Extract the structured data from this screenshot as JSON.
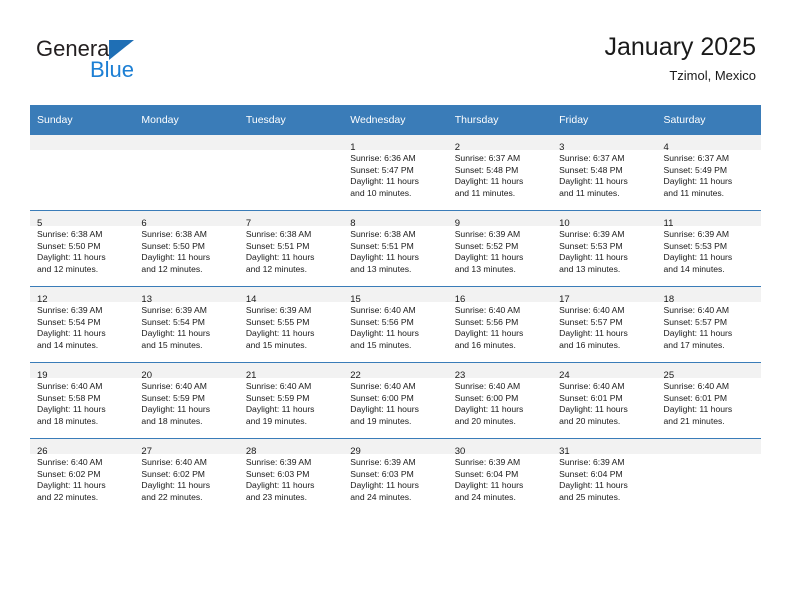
{
  "brand": {
    "name_top": "General",
    "name_bottom": "Blue",
    "triangle_color": "#1f6fb5",
    "blue_color": "#1c7fd4"
  },
  "header": {
    "title": "January 2025",
    "subtitle": "Tzimol, Mexico"
  },
  "theme": {
    "header_bg": "#3a7cb8",
    "daynum_bg": "#f2f2f2",
    "text": "#1a1a1a"
  },
  "calendar": {
    "weekday_headers": [
      "Sunday",
      "Monday",
      "Tuesday",
      "Wednesday",
      "Thursday",
      "Friday",
      "Saturday"
    ],
    "weeks": [
      [
        {
          "day": "",
          "lines": []
        },
        {
          "day": "",
          "lines": []
        },
        {
          "day": "",
          "lines": []
        },
        {
          "day": "1",
          "lines": [
            "Sunrise: 6:36 AM",
            "Sunset: 5:47 PM",
            "Daylight: 11 hours",
            "and 10 minutes."
          ]
        },
        {
          "day": "2",
          "lines": [
            "Sunrise: 6:37 AM",
            "Sunset: 5:48 PM",
            "Daylight: 11 hours",
            "and 11 minutes."
          ]
        },
        {
          "day": "3",
          "lines": [
            "Sunrise: 6:37 AM",
            "Sunset: 5:48 PM",
            "Daylight: 11 hours",
            "and 11 minutes."
          ]
        },
        {
          "day": "4",
          "lines": [
            "Sunrise: 6:37 AM",
            "Sunset: 5:49 PM",
            "Daylight: 11 hours",
            "and 11 minutes."
          ]
        }
      ],
      [
        {
          "day": "5",
          "lines": [
            "Sunrise: 6:38 AM",
            "Sunset: 5:50 PM",
            "Daylight: 11 hours",
            "and 12 minutes."
          ]
        },
        {
          "day": "6",
          "lines": [
            "Sunrise: 6:38 AM",
            "Sunset: 5:50 PM",
            "Daylight: 11 hours",
            "and 12 minutes."
          ]
        },
        {
          "day": "7",
          "lines": [
            "Sunrise: 6:38 AM",
            "Sunset: 5:51 PM",
            "Daylight: 11 hours",
            "and 12 minutes."
          ]
        },
        {
          "day": "8",
          "lines": [
            "Sunrise: 6:38 AM",
            "Sunset: 5:51 PM",
            "Daylight: 11 hours",
            "and 13 minutes."
          ]
        },
        {
          "day": "9",
          "lines": [
            "Sunrise: 6:39 AM",
            "Sunset: 5:52 PM",
            "Daylight: 11 hours",
            "and 13 minutes."
          ]
        },
        {
          "day": "10",
          "lines": [
            "Sunrise: 6:39 AM",
            "Sunset: 5:53 PM",
            "Daylight: 11 hours",
            "and 13 minutes."
          ]
        },
        {
          "day": "11",
          "lines": [
            "Sunrise: 6:39 AM",
            "Sunset: 5:53 PM",
            "Daylight: 11 hours",
            "and 14 minutes."
          ]
        }
      ],
      [
        {
          "day": "12",
          "lines": [
            "Sunrise: 6:39 AM",
            "Sunset: 5:54 PM",
            "Daylight: 11 hours",
            "and 14 minutes."
          ]
        },
        {
          "day": "13",
          "lines": [
            "Sunrise: 6:39 AM",
            "Sunset: 5:54 PM",
            "Daylight: 11 hours",
            "and 15 minutes."
          ]
        },
        {
          "day": "14",
          "lines": [
            "Sunrise: 6:39 AM",
            "Sunset: 5:55 PM",
            "Daylight: 11 hours",
            "and 15 minutes."
          ]
        },
        {
          "day": "15",
          "lines": [
            "Sunrise: 6:40 AM",
            "Sunset: 5:56 PM",
            "Daylight: 11 hours",
            "and 15 minutes."
          ]
        },
        {
          "day": "16",
          "lines": [
            "Sunrise: 6:40 AM",
            "Sunset: 5:56 PM",
            "Daylight: 11 hours",
            "and 16 minutes."
          ]
        },
        {
          "day": "17",
          "lines": [
            "Sunrise: 6:40 AM",
            "Sunset: 5:57 PM",
            "Daylight: 11 hours",
            "and 16 minutes."
          ]
        },
        {
          "day": "18",
          "lines": [
            "Sunrise: 6:40 AM",
            "Sunset: 5:57 PM",
            "Daylight: 11 hours",
            "and 17 minutes."
          ]
        }
      ],
      [
        {
          "day": "19",
          "lines": [
            "Sunrise: 6:40 AM",
            "Sunset: 5:58 PM",
            "Daylight: 11 hours",
            "and 18 minutes."
          ]
        },
        {
          "day": "20",
          "lines": [
            "Sunrise: 6:40 AM",
            "Sunset: 5:59 PM",
            "Daylight: 11 hours",
            "and 18 minutes."
          ]
        },
        {
          "day": "21",
          "lines": [
            "Sunrise: 6:40 AM",
            "Sunset: 5:59 PM",
            "Daylight: 11 hours",
            "and 19 minutes."
          ]
        },
        {
          "day": "22",
          "lines": [
            "Sunrise: 6:40 AM",
            "Sunset: 6:00 PM",
            "Daylight: 11 hours",
            "and 19 minutes."
          ]
        },
        {
          "day": "23",
          "lines": [
            "Sunrise: 6:40 AM",
            "Sunset: 6:00 PM",
            "Daylight: 11 hours",
            "and 20 minutes."
          ]
        },
        {
          "day": "24",
          "lines": [
            "Sunrise: 6:40 AM",
            "Sunset: 6:01 PM",
            "Daylight: 11 hours",
            "and 20 minutes."
          ]
        },
        {
          "day": "25",
          "lines": [
            "Sunrise: 6:40 AM",
            "Sunset: 6:01 PM",
            "Daylight: 11 hours",
            "and 21 minutes."
          ]
        }
      ],
      [
        {
          "day": "26",
          "lines": [
            "Sunrise: 6:40 AM",
            "Sunset: 6:02 PM",
            "Daylight: 11 hours",
            "and 22 minutes."
          ]
        },
        {
          "day": "27",
          "lines": [
            "Sunrise: 6:40 AM",
            "Sunset: 6:02 PM",
            "Daylight: 11 hours",
            "and 22 minutes."
          ]
        },
        {
          "day": "28",
          "lines": [
            "Sunrise: 6:39 AM",
            "Sunset: 6:03 PM",
            "Daylight: 11 hours",
            "and 23 minutes."
          ]
        },
        {
          "day": "29",
          "lines": [
            "Sunrise: 6:39 AM",
            "Sunset: 6:03 PM",
            "Daylight: 11 hours",
            "and 24 minutes."
          ]
        },
        {
          "day": "30",
          "lines": [
            "Sunrise: 6:39 AM",
            "Sunset: 6:04 PM",
            "Daylight: 11 hours",
            "and 24 minutes."
          ]
        },
        {
          "day": "31",
          "lines": [
            "Sunrise: 6:39 AM",
            "Sunset: 6:04 PM",
            "Daylight: 11 hours",
            "and 25 minutes."
          ]
        },
        {
          "day": "",
          "lines": []
        }
      ]
    ]
  }
}
